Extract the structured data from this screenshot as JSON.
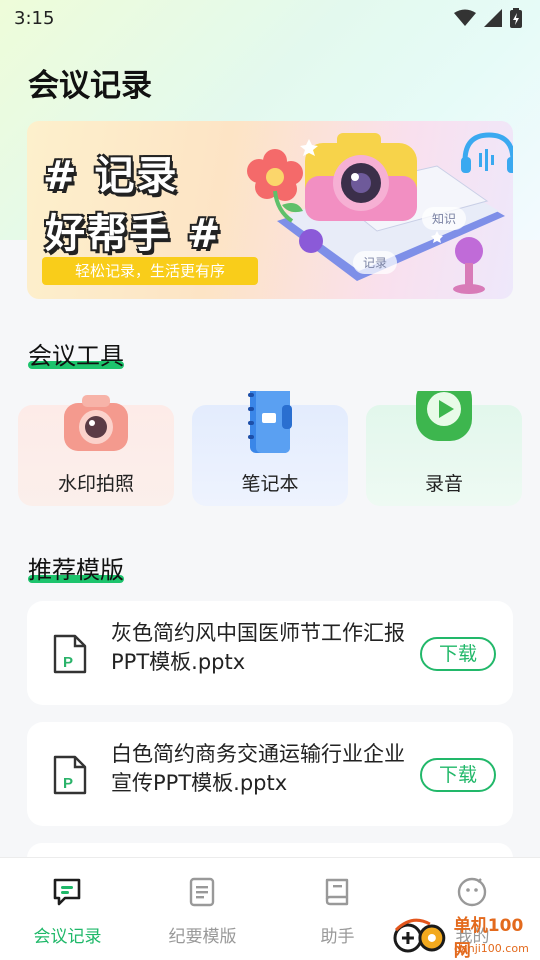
{
  "status_bar": {
    "time": "3:15"
  },
  "header": {
    "title": "会议记录"
  },
  "banner": {
    "line1": "# 记录",
    "line2": "好帮手 #",
    "subtitle": "轻松记录，生活更有序",
    "chip_knowledge": "知识",
    "chip_record": "记录"
  },
  "tools_section": {
    "title": "会议工具",
    "items": [
      {
        "label": "水印拍照",
        "icon": "camera-icon"
      },
      {
        "label": "笔记本",
        "icon": "notebook-icon"
      },
      {
        "label": "录音",
        "icon": "play-icon"
      }
    ]
  },
  "templates_section": {
    "title": "推荐模版",
    "items": [
      {
        "name": "灰色简约风中国医师节工作汇报PPT模板.pptx",
        "button": "下载"
      },
      {
        "name": "白色简约商务交通运输行业企业宣传PPT模板.pptx",
        "button": "下载"
      }
    ]
  },
  "bottom_nav": {
    "items": [
      {
        "label": "会议记录",
        "icon": "chat-icon",
        "active": true
      },
      {
        "label": "纪要模版",
        "icon": "document-icon",
        "active": false
      },
      {
        "label": "助手",
        "icon": "book-icon",
        "active": false
      },
      {
        "label": "我的",
        "icon": "smile-icon",
        "active": false
      }
    ]
  },
  "watermark": {
    "text": "单机100网",
    "sub": "danji100.com"
  },
  "colors": {
    "accent": "#1fb869",
    "banner_yellow": "#f9cd1a"
  }
}
